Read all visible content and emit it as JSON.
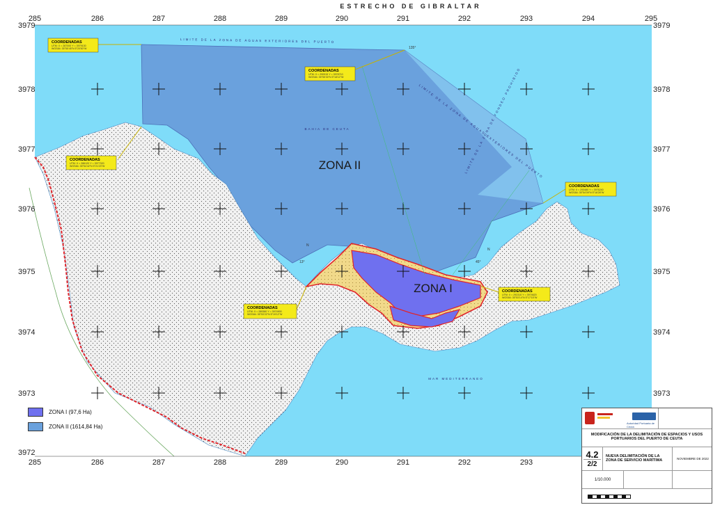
{
  "map": {
    "top_title": "ESTRECHO DE GIBRALTAR",
    "x_grid_labels": [
      "285",
      "286",
      "287",
      "288",
      "289",
      "290",
      "291",
      "292",
      "293",
      "294",
      "295"
    ],
    "y_grid_labels_left": [
      "3979",
      "3978",
      "3977",
      "3976",
      "3975",
      "3974",
      "3973",
      "3972"
    ],
    "y_grid_labels_right": [
      "3979",
      "3978",
      "3977",
      "3976",
      "3975",
      "3974",
      "3973"
    ],
    "zones": [
      {
        "label": "ZONA I",
        "color": "#6f70ef"
      },
      {
        "label": "ZONA II",
        "color": "#6aa1dd"
      }
    ],
    "sea_color": "#7fdcf9",
    "land_color": "#f1f1f1",
    "yellow_zone_color": "#f1d98a",
    "boundary_color": "#e0242a",
    "water_labels": {
      "limit_exterior": "LIMITE DE LA ZONA DE AGUAS EXTERIORES DEL PUERTO",
      "limit_fondeo": "LIMITE DE LA ZONA DE FONDEO PROHIBIDO",
      "limit_exteriores_right": "LIMITE DE LA ZONA DE AGUAS EXTERIORES DEL PUERTO",
      "bahia": "BAHIA DE CEUTA",
      "mar": "MAR MEDITERRANEO"
    },
    "callouts": [
      {
        "title": "COORDENADAS",
        "lines": [
          "UTM: X = 287000 Y = 3979130",
          "WGS84: 35°55'45\"N 5°20'50\"W"
        ]
      },
      {
        "title": "COORDENADAS",
        "lines": [
          "UTM: X = 290915 Y = 3978710",
          "WGS84: 35°55'30\"N 5°18'12\"W"
        ]
      },
      {
        "title": "COORDENADAS",
        "lines": [
          "UTM: X = 286120 Y = 3977320",
          "WGS84: 35°54'42\"N 5°21'23\"W"
        ]
      },
      {
        "title": "COORDENADAS",
        "lines": [
          "UTM: X = 293480 Y = 3976240",
          "WGS84: 35°54'09\"N 5°16'28\"W"
        ]
      },
      {
        "title": "COORDENADAS",
        "lines": [
          "UTM: X = 289380 Y = 3974900",
          "WGS84: 35°53'22\"N 5°19'12\"W"
        ]
      },
      {
        "title": "COORDENADAS",
        "lines": [
          "UTM: X = 292310 Y = 3974620",
          "WGS84: 35°53'14\"N 5°17'15\"W"
        ]
      }
    ],
    "angles": [
      "135°",
      "45°",
      "13°"
    ],
    "north_marks": [
      "N",
      "N"
    ]
  },
  "legend": {
    "items": [
      {
        "label": "ZONA I (97,6 Ha)",
        "color": "#6f70ef"
      },
      {
        "label": "ZONA II (1614,84 Ha)",
        "color": "#6aa1dd"
      }
    ]
  },
  "title_block": {
    "org": "Autoridad Portuaria de Ceuta",
    "project_title": "MODIFICACIÓN DE LA DELIMITACIÓN DE ESPACIOS Y USOS PORTUARIOS DEL PUERTO DE CEUTA",
    "plan_number": "4.2",
    "sheet": "2/2",
    "plan_title": "NUEVA DELIMITACIÓN DE LA ZONA DE SERVICIO MARÍTIMA",
    "date": "NOVIEMBRE DE 2022",
    "scale": "1/10.000"
  }
}
